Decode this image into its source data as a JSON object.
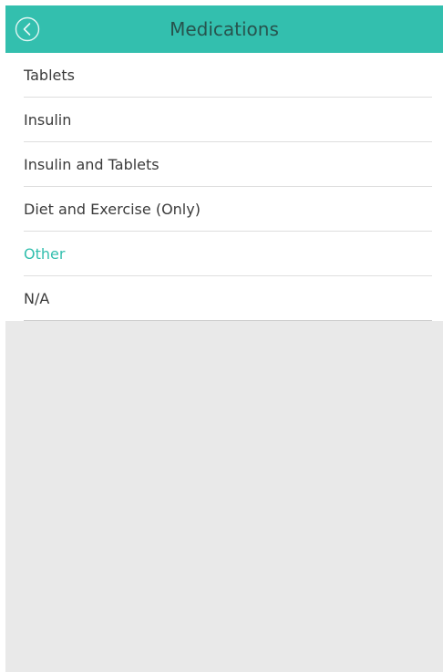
{
  "header": {
    "title": "Medications",
    "back_icon": "chevron-left-circle-icon"
  },
  "colors": {
    "accent": "#33bfae",
    "title_text": "#27534d",
    "item_text": "#3b3b3b",
    "background": "#e9e9e9"
  },
  "medications": {
    "selected": "Other",
    "options": [
      {
        "label": "Tablets"
      },
      {
        "label": "Insulin"
      },
      {
        "label": "Insulin and Tablets"
      },
      {
        "label": "Diet and Exercise (Only)"
      },
      {
        "label": "Other"
      },
      {
        "label": "N/A"
      }
    ]
  }
}
